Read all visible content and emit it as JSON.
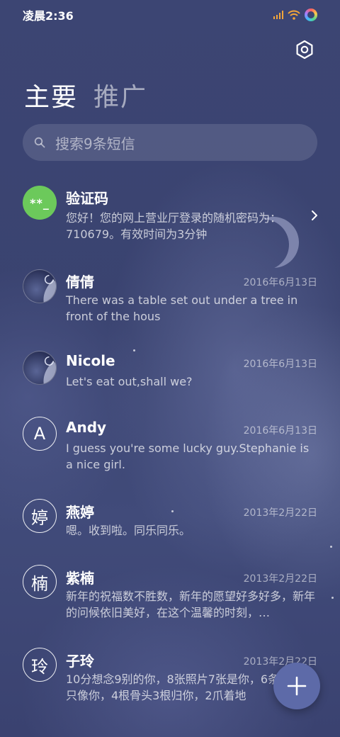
{
  "status_bar": {
    "time": "凌晨2:36"
  },
  "tabs": [
    {
      "label": "主要",
      "active": true
    },
    {
      "label": "推广",
      "active": false
    }
  ],
  "search": {
    "placeholder": "搜索9条短信"
  },
  "messages": [
    {
      "name": "验证码",
      "avatar": "**_",
      "avatar_type": "code",
      "date": "",
      "preview": "您好！您的网上营业厅登录的随机密码为：710679。有效时间为3分钟"
    },
    {
      "name": "倩倩",
      "avatar_type": "photo",
      "date": "2016年6月13日",
      "preview": "There was a table set out under a tree in front of the hous"
    },
    {
      "name": "Nicole",
      "avatar_type": "photo",
      "date": "2016年6月13日",
      "preview": "Let's eat out,shall we?"
    },
    {
      "name": "Andy",
      "avatar": "A",
      "avatar_type": "letter",
      "date": "2016年6月13日",
      "preview": "I guess you're some lucky guy.Stephanie is a nice girl."
    },
    {
      "name": "燕婷",
      "avatar": "婷",
      "avatar_type": "letter",
      "date": "2013年2月22日",
      "preview": "嗯。收到啦。同乐同乐。"
    },
    {
      "name": "紫楠",
      "avatar": "楠",
      "avatar_type": "letter",
      "date": "2013年2月22日",
      "preview": "新年的祝福数不胜数，新年的愿望好多好多，新年的问候依旧美好，在这个温馨的时刻，…"
    },
    {
      "name": "子玲",
      "avatar": "玲",
      "avatar_type": "letter",
      "date": "2013年2月22日",
      "preview": "10分想念9别的你，8张照片7张是你，6条小狗5只像你，4根骨头3根归你，2爪着地"
    }
  ],
  "icons": {
    "settings": "gear-icon",
    "search": "search-icon",
    "chevron": "chevron-right-icon",
    "fab": "plus-icon"
  },
  "colors": {
    "background": "#3b4470",
    "code_avatar": "#6cc95b",
    "fab": "#5d6aa8"
  }
}
